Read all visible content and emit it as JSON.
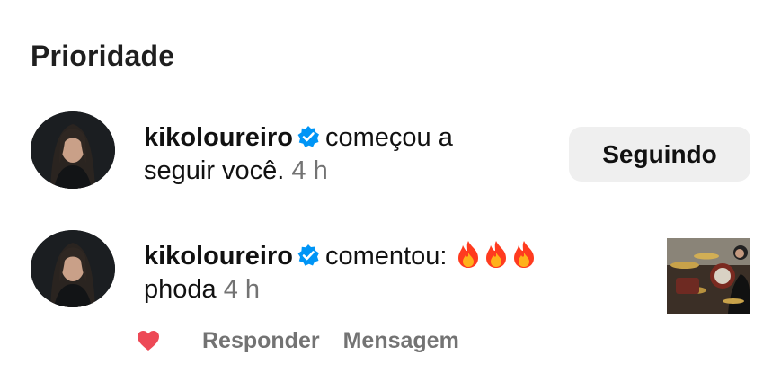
{
  "section": {
    "title": "Prioridade"
  },
  "notifications": [
    {
      "username": "kikoloureiro",
      "verified": true,
      "action_line1": "começou a",
      "action_line2": "seguir você.",
      "time": "4 h",
      "button_label": "Seguindo"
    },
    {
      "username": "kikoloureiro",
      "verified": true,
      "action": "comentou:",
      "emoji_icons": [
        "fire-icon",
        "fire-icon",
        "fire-icon"
      ],
      "comment": "phoda",
      "time": "4 h",
      "actions": {
        "like_icon": "heart-icon",
        "like_color": "#ed4956",
        "reply_label": "Responder",
        "message_label": "Mensagem"
      }
    }
  ],
  "colors": {
    "verified_badge": "#0095f6",
    "secondary_text": "#737373",
    "button_bg": "#efefef"
  }
}
